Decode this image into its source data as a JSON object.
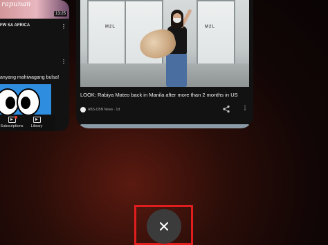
{
  "recents": {
    "left_card": {
      "thumb_text": "rapunan",
      "thumb_duration": "13:25",
      "video1_title": "FW SA AFRICA",
      "video2_title": "anyang mahiwagang bulsa!",
      "nav": {
        "subscriptions_label": "Subscriptions",
        "library_label": "Library"
      }
    },
    "right_card": {
      "video_title": "LOOK: Rabiya Mateo back in Manila after more than 2 months in US",
      "channel_line": "ABS-CBN News · 1d",
      "photo_sign_text": "M2L"
    },
    "close_button": {
      "icon": "close-icon",
      "highlight_color": "#e01e1e"
    }
  }
}
